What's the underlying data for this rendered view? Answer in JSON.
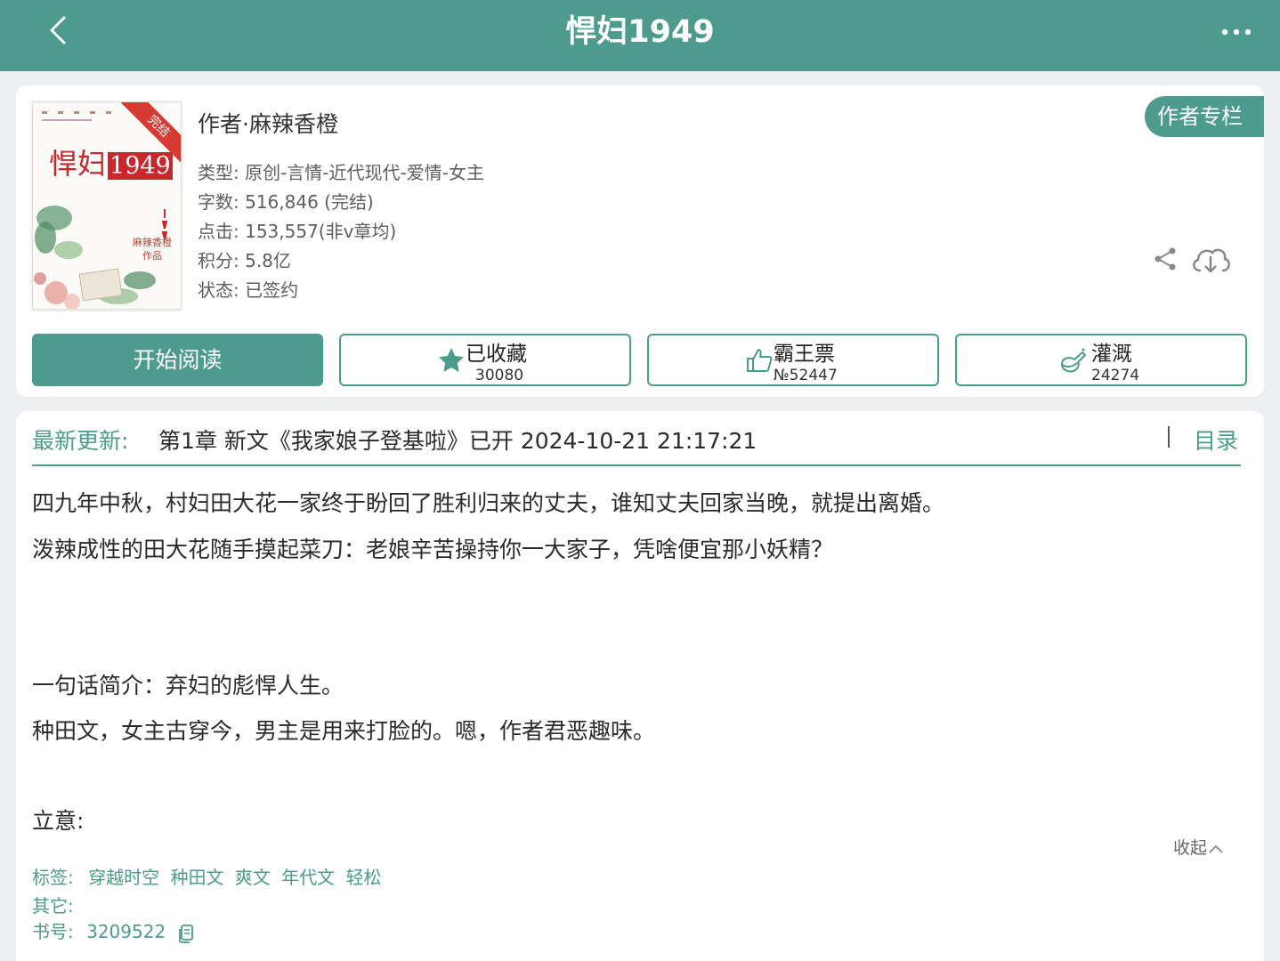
{
  "header": {
    "title": "悍妇1949"
  },
  "book": {
    "cover": {
      "title_text": "悍妇",
      "title_num": "1949",
      "ribbon": "完结",
      "author_line1": "麻辣香橙",
      "author_line2": "作品"
    },
    "author_line": "作者·麻辣香橙",
    "meta": {
      "genre": "类型: 原创-言情-近代现代-爱情-女主",
      "words": "字数: 516,846 (完结)",
      "clicks": "点击: 153,557(非v章均)",
      "score": "积分: 5.8亿",
      "status": "状态: 已签约"
    },
    "column_button": "作者专栏"
  },
  "actions": {
    "read": "开始阅读",
    "favorite": {
      "label": "已收藏",
      "count": "30080"
    },
    "bawang": {
      "label": "霸王票",
      "count": "№52447"
    },
    "irrigate": {
      "label": "灌溉",
      "count": "24274"
    }
  },
  "update": {
    "label": "最新更新:",
    "text": "第1章  新文《我家娘子登基啦》已开  2024-10-21 21:17:21",
    "toc": "目录"
  },
  "description": {
    "p1": "四九年中秋，村妇田大花一家终于盼回了胜利归来的丈夫，谁知丈夫回家当晚，就提出离婚。",
    "p2": "泼辣成性的田大花随手摸起菜刀：老娘辛苦操持你一大家子，凭啥便宜那小妖精？",
    "p3": "一句话简介：弃妇的彪悍人生。",
    "p4": "种田文，女主古穿今，男主是用来打脸的。嗯，作者君恶趣味。",
    "p5": "立意:",
    "collapse": "收起"
  },
  "tags": {
    "label": "标签:",
    "items": [
      "穿越时空",
      "种田文",
      "爽文",
      "年代文",
      "轻松"
    ],
    "other_label": "其它:",
    "id_label": "书号:",
    "id_value": "3209522"
  },
  "colors": {
    "accent": "#4d9b8c",
    "background": "#eeeff0"
  }
}
